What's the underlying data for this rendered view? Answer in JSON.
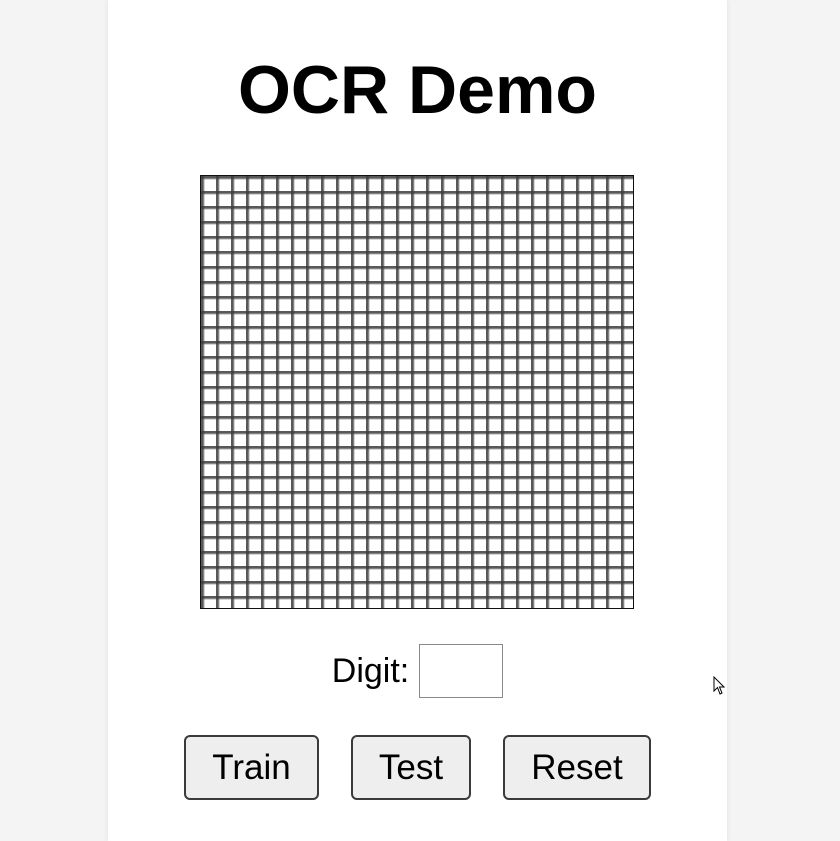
{
  "app": {
    "title": "OCR Demo"
  },
  "grid": {
    "cells_per_side": 28
  },
  "digit": {
    "label": "Digit:",
    "value": ""
  },
  "buttons": {
    "train_label": "Train",
    "test_label": "Test",
    "reset_label": "Reset"
  },
  "colors": {
    "page_background": "#f4f4f4",
    "card_background": "#ffffff",
    "grid_line": "#3c3c3c",
    "button_background": "#eeeeee",
    "button_border": "#3a3a3a"
  }
}
